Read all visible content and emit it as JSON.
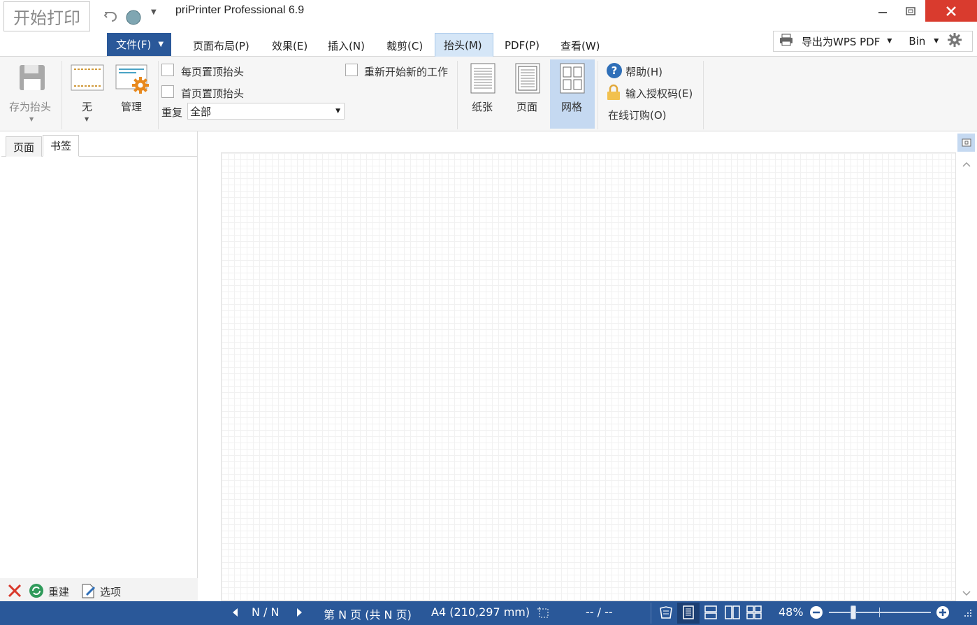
{
  "app": {
    "start_print": "开始打印",
    "title": "priPrinter Professional 6.9"
  },
  "menu": {
    "file_label": "文件(F)",
    "tabs": [
      {
        "label": "页面布局(P)"
      },
      {
        "label": "效果(E)"
      },
      {
        "label": "插入(N)"
      },
      {
        "label": "裁剪(C)"
      },
      {
        "label": "抬头(M)"
      },
      {
        "label": "PDF(P)"
      },
      {
        "label": "查看(W)"
      }
    ],
    "active_tab": "抬头(M)"
  },
  "export": {
    "label": "导出为WPS PDF",
    "bin": "Bin"
  },
  "ribbon": {
    "save_header": "存为抬头",
    "none": "无",
    "manage": "管理",
    "each_page_top": "每页置顶抬头",
    "first_page_top": "首页置顶抬头",
    "repeat_label": "重复",
    "repeat_value": "全部",
    "restart_job": "重新开始新的工作",
    "paper": "纸张",
    "page": "页面",
    "grid": "网格",
    "help": "帮助(H)",
    "license": "输入授权码(E)",
    "buy": "在线订购(O)"
  },
  "left_panel": {
    "tab_pages": "页面",
    "tab_bookmarks": "书签",
    "rebuild": "重建",
    "options": "选项"
  },
  "status": {
    "page_counter": "N / N",
    "page_info": "第 N 页 (共 N 页)",
    "paper_size": "A4 (210,297 mm)",
    "position": "-- / --",
    "zoom": "48%",
    "zoom_level": 0.48
  },
  "colors": {
    "accent": "#2a5899",
    "active_tab_bg": "#d5e6f7",
    "close_red": "#d93b2e",
    "grid_btn_bg": "#c5d9f1"
  }
}
